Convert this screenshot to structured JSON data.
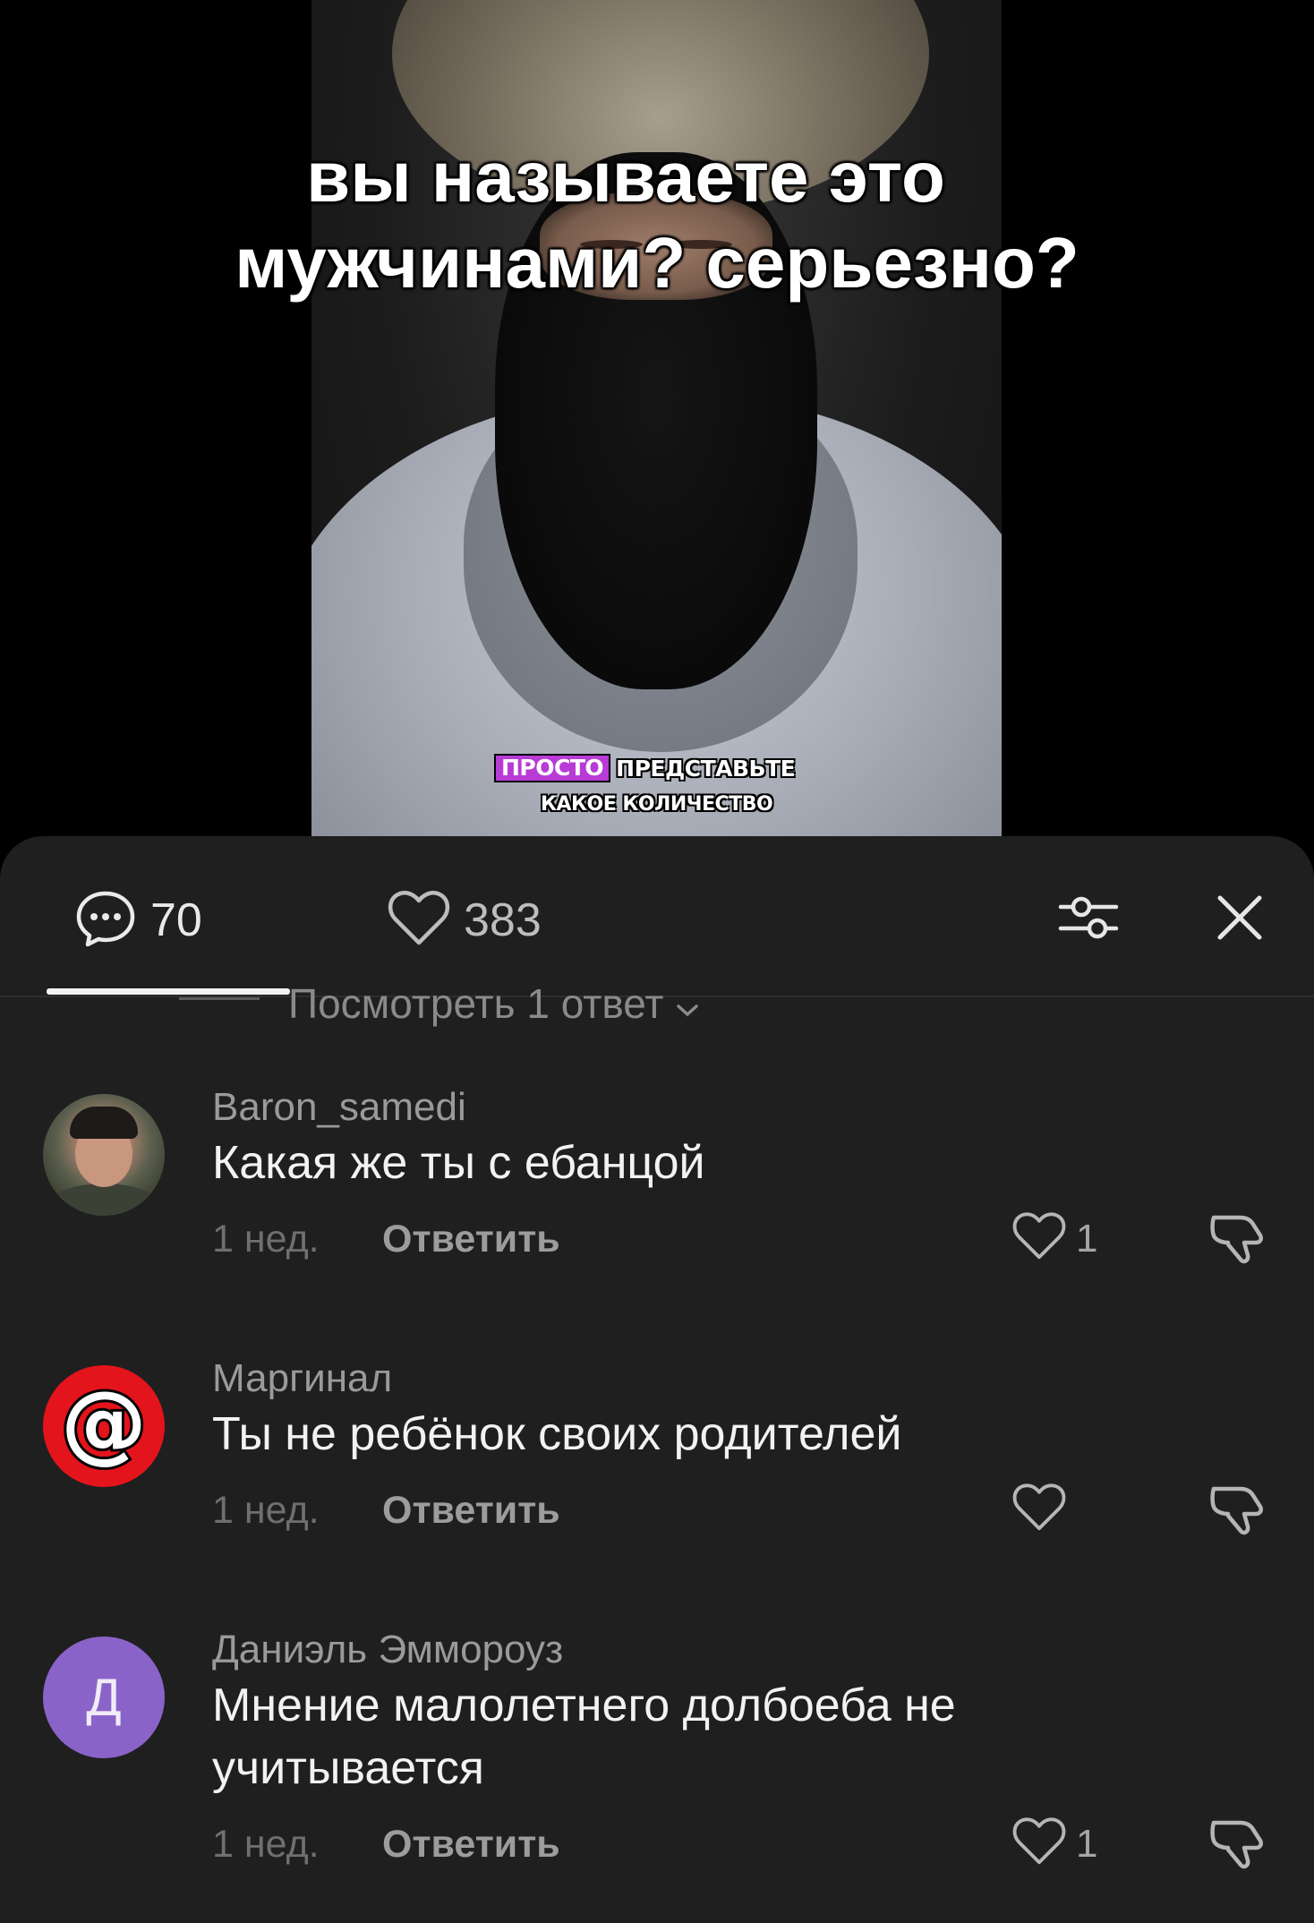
{
  "video": {
    "overlay_title_line1": "вы называете это",
    "overlay_title_line2": "мужчинами? серьезно?",
    "subtitle_highlight": "ПРОСТО",
    "subtitle_rest": "ПРЕДСТАВЬТЕ",
    "subtitle_line2": "КАКОЕ КОЛИЧЕСТВО"
  },
  "sheet_header": {
    "comments_count": "70",
    "likes_count": "383",
    "filter_icon": "filter-sliders-icon",
    "close_icon": "close-icon"
  },
  "clipped": {
    "view_replies": "Посмотреть 1 ответ"
  },
  "comments": [
    {
      "username": "Baron_samedi",
      "text": "Какая же ты с ебанцой",
      "time": "1 нед.",
      "reply_label": "Ответить",
      "likes": "1"
    },
    {
      "username": "Маргинал",
      "text": "Ты не ребёнок своих родителей",
      "time": "1 нед.",
      "reply_label": "Ответить",
      "likes": "",
      "avatar_glyph": "@"
    },
    {
      "username": "Даниэль Эммороуз",
      "text": "Мнение малолетнего долбоеба не учитывается",
      "time": "1 нед.",
      "reply_label": "Ответить",
      "likes": "1",
      "avatar_letter": "Д"
    }
  ],
  "colors": {
    "sheet_bg": "#1f1f1f",
    "subtitle_highlight": "#b83bd6",
    "avatar_purple": "#8a63c9",
    "avatar_red": "#e3141c"
  }
}
